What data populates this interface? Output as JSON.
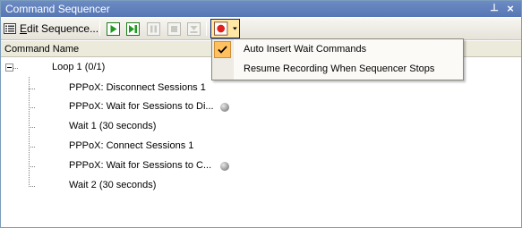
{
  "window": {
    "title": "Command Sequencer",
    "pin_glyph": "⊥",
    "close_glyph": "×"
  },
  "toolbar": {
    "edit_label_underlined": "E",
    "edit_label_rest": "dit Sequence...",
    "buttons": [
      {
        "name": "play",
        "icon": "play-icon",
        "enabled": true
      },
      {
        "name": "step",
        "icon": "step-play-icon",
        "enabled": true
      },
      {
        "name": "pause",
        "icon": "pause-icon",
        "enabled": false
      },
      {
        "name": "stop",
        "icon": "stop-icon",
        "enabled": false
      },
      {
        "name": "jump",
        "icon": "jump-icon",
        "enabled": false
      },
      {
        "name": "record",
        "icon": "record-icon",
        "enabled": true,
        "active": true
      }
    ]
  },
  "table": {
    "column_header": "Command Name",
    "rows": [
      {
        "label": "Loop 1 (0/1)",
        "level": 0,
        "expanded": true,
        "status_dot": false
      },
      {
        "label": "PPPoX: Disconnect Sessions 1",
        "level": 1,
        "status_dot": false
      },
      {
        "label": "PPPoX: Wait for Sessions to Di...",
        "level": 1,
        "status_dot": true
      },
      {
        "label": "Wait 1 (30 seconds)",
        "level": 1,
        "status_dot": false
      },
      {
        "label": "PPPoX: Connect Sessions 1",
        "level": 1,
        "status_dot": false
      },
      {
        "label": "PPPoX: Wait for Sessions to C...",
        "level": 1,
        "status_dot": true
      },
      {
        "label": "Wait 2 (30 seconds)",
        "level": 1,
        "status_dot": false
      }
    ]
  },
  "record_menu": {
    "items": [
      {
        "label": "Auto Insert Wait Commands",
        "checked": true
      },
      {
        "label": "Resume Recording When Sequencer Stops",
        "checked": false
      }
    ]
  },
  "colors": {
    "titlebar": "#5f7fbb",
    "play_green": "#1f9a1f",
    "record_red": "#e0201c",
    "menu_highlight": "#ffc060"
  }
}
